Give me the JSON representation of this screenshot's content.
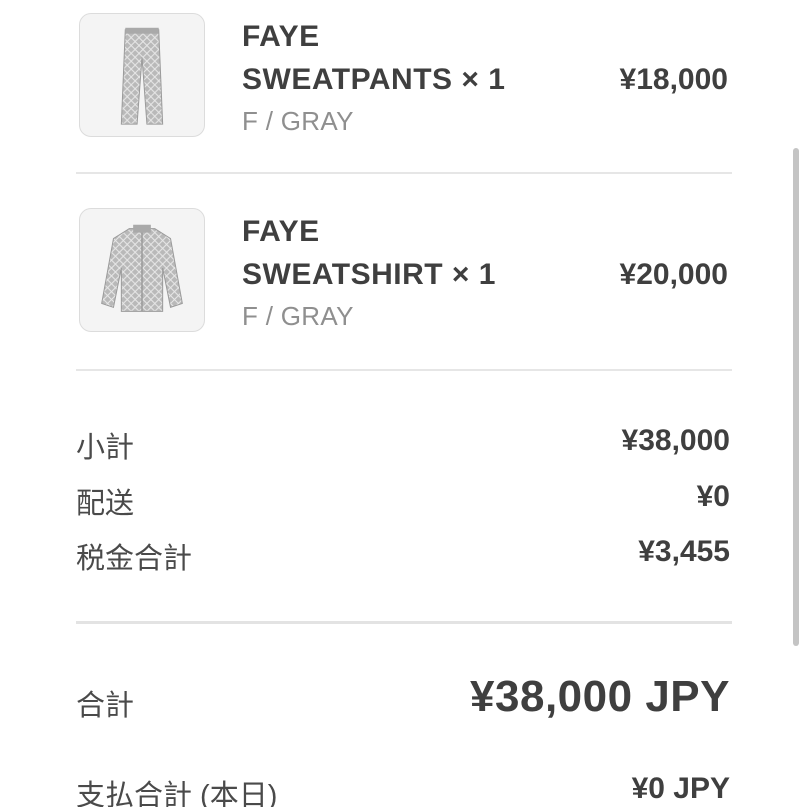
{
  "items": [
    {
      "brand": "FAYE",
      "name": "SWEATPANTS × 1",
      "variant": "F / GRAY",
      "price": "¥18,000",
      "thumbnail_icon": "sweatpants-thumbnail"
    },
    {
      "brand": "FAYE",
      "name": "SWEATSHIRT × 1",
      "variant": "F / GRAY",
      "price": "¥20,000",
      "thumbnail_icon": "sweatshirt-thumbnail"
    }
  ],
  "summary": {
    "subtotal_label": "小計",
    "subtotal_value": "¥38,000",
    "shipping_label": "配送",
    "shipping_value": "¥0",
    "tax_label": "税金合計",
    "tax_value": "¥3,455",
    "total_label": "合計",
    "total_value": "¥38,000 JPY",
    "paytoday_label": "支払合計 (本日)",
    "paytoday_value": "¥0 JPY"
  },
  "colors": {
    "text": "#3f3f3f",
    "muted_text": "#8f8f8f",
    "divider": "#e6e6e6",
    "thumbnail_bg": "#f4f4f4"
  }
}
